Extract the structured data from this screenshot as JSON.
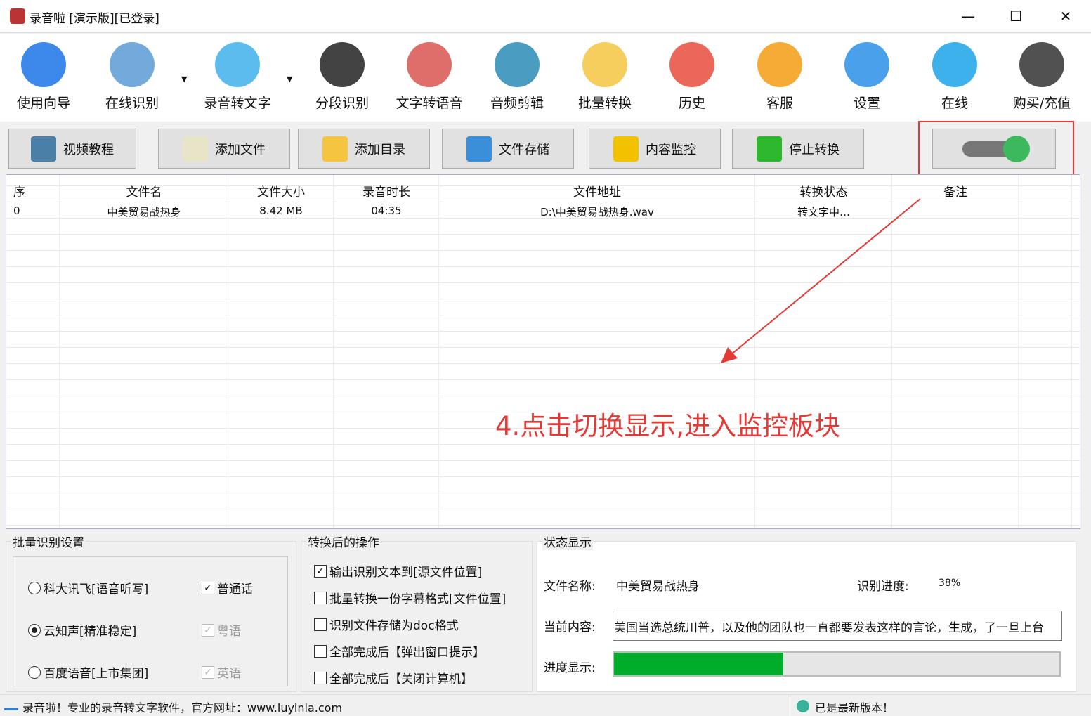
{
  "window": {
    "title": "录音啦 [演示版][已登录]",
    "minimize": "—",
    "maximize": "☐",
    "close": "✕"
  },
  "toolbar": [
    {
      "label": "使用向导",
      "icon": "navigation-arrow-icon",
      "color": "#1a73e8"
    },
    {
      "label": "在线识别",
      "icon": "microphone-icon",
      "color": "#5b9bd5",
      "dropdown": "▼"
    },
    {
      "label": "录音转文字",
      "icon": "w-logo-icon",
      "color": "#3fb0ea",
      "dropdown": "▼"
    },
    {
      "label": "分段识别",
      "icon": "waveform-icon",
      "color": "#222"
    },
    {
      "label": "文字转语音",
      "icon": "megaphone-icon",
      "color": "#d9534f"
    },
    {
      "label": "音频剪辑",
      "icon": "scissors-icon",
      "color": "#2a8bb5"
    },
    {
      "label": "批量转换",
      "icon": "folder-convert-icon",
      "color": "#f5c542"
    },
    {
      "label": "历史",
      "icon": "history-clock-icon",
      "color": "#e74c3c"
    },
    {
      "label": "客服",
      "icon": "sleeping-bed-icon",
      "color": "#f39c12"
    },
    {
      "label": "设置",
      "icon": "lifebuoy-icon",
      "color": "#2b8fe8"
    },
    {
      "label": "在线",
      "icon": "user-circle-icon",
      "color": "#1aa3e8"
    },
    {
      "label": "购买/充值",
      "icon": "dollar-coin-icon",
      "color": "#333"
    }
  ],
  "buttons": [
    {
      "label": "视频教程",
      "icon": "video-camera-icon",
      "color": "#4a7fa8"
    },
    {
      "label": "添加文件",
      "icon": "add-file-icon",
      "color": "#e8e4c8"
    },
    {
      "label": "添加目录",
      "icon": "folder-icon",
      "color": "#f5c542"
    },
    {
      "label": "文件存储",
      "icon": "floppy-disk-icon",
      "color": "#3a8fd8"
    },
    {
      "label": "内容监控",
      "icon": "lightning-icon",
      "color": "#f2c200"
    },
    {
      "label": "停止转换",
      "icon": "play-icon",
      "color": "#2db82d"
    }
  ],
  "toggle": {
    "on": true,
    "color": "#3cb95c"
  },
  "table": {
    "headers": [
      "序",
      "文件名",
      "文件大小",
      "录音时长",
      "文件地址",
      "转换状态",
      "备注"
    ],
    "rows": [
      [
        "0",
        "中美贸易战热身",
        "8.42 MB",
        "04:35",
        "D:\\中美贸易战热身.wav",
        "转文字中…",
        ""
      ]
    ]
  },
  "annotation": {
    "text": "4.点击切换显示,进入监控板块",
    "color": "#e53935"
  },
  "batch": {
    "title": "批量识别设置",
    "options": [
      {
        "label": "科大讯飞[语音听写]",
        "selected": false
      },
      {
        "label": "云知声[精准稳定]",
        "selected": true
      },
      {
        "label": "百度语音[上市集团]",
        "selected": false
      }
    ],
    "langs": [
      {
        "label": "普通话",
        "checked": true,
        "disabled": false
      },
      {
        "label": "粤语",
        "checked": true,
        "disabled": true
      },
      {
        "label": "英语",
        "checked": true,
        "disabled": true
      }
    ]
  },
  "after": {
    "title": "转换后的操作",
    "items": [
      {
        "label": "输出识别文本到[源文件位置]",
        "checked": true
      },
      {
        "label": "批量转换一份字幕格式[文件位置]",
        "checked": false
      },
      {
        "label": "识别文件存储为doc格式",
        "checked": false
      },
      {
        "label": "全部完成后【弹出窗口提示】",
        "checked": false
      },
      {
        "label": "全部完成后【关闭计算机】",
        "checked": false
      }
    ]
  },
  "status": {
    "title": "状态显示",
    "file_label": "文件名称:",
    "file_value": "中美贸易战热身",
    "progress_label": "识别进度:",
    "progress_value": "38%",
    "progress": 38,
    "content_label": "当前内容:",
    "content_value": "美国当选总统川普，以及他的团队也一直都要发表这样的言论，生成，了一旦上台",
    "bar_label": "进度显示:",
    "bar_color": "#00ad2a"
  },
  "statusbar": {
    "left": "录音啦！专业的录音转文字软件，官方网址：www.luyinla.com",
    "right": "已是最新版本！"
  }
}
